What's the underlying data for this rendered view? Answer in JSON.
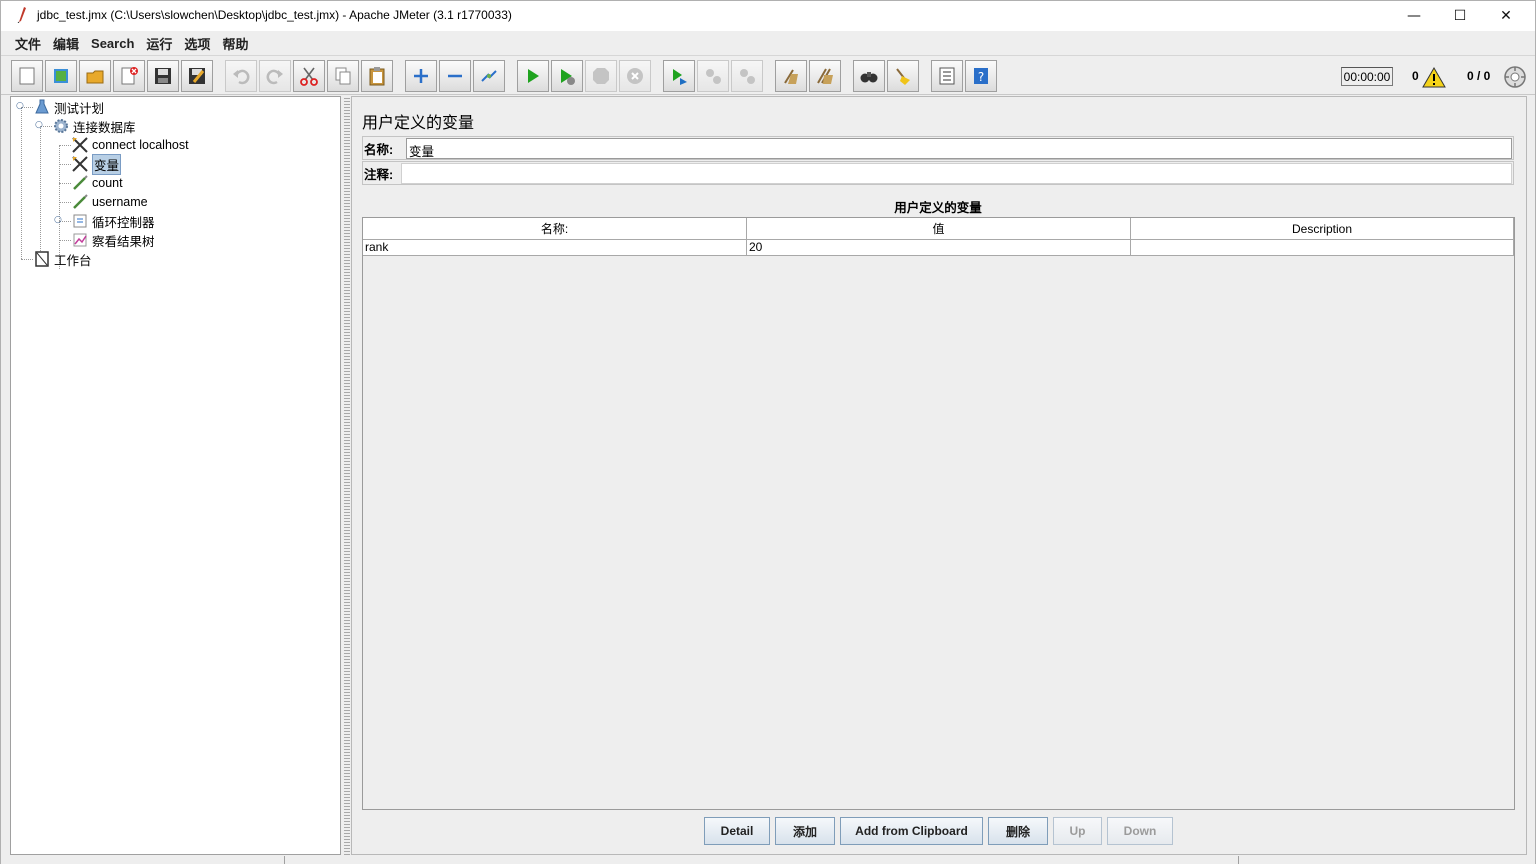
{
  "window": {
    "title": "jdbc_test.jmx (C:\\Users\\slowchen\\Desktop\\jdbc_test.jmx) - Apache JMeter (3.1 r1770033)",
    "controls": {
      "minimize": "—",
      "maximize": "☐",
      "close": "✕"
    }
  },
  "menubar": {
    "items": [
      "文件",
      "编辑",
      "Search",
      "运行",
      "选项",
      "帮助"
    ]
  },
  "toolbar": {
    "buttons": [
      "new-icon",
      "templates-icon",
      "open-icon",
      "close-file-icon",
      "save-icon",
      "save-as-icon",
      "undo-icon",
      "redo-icon",
      "cut-icon",
      "copy-icon",
      "paste-icon",
      "expand-icon",
      "collapse-icon",
      "toggle-icon",
      "start-icon",
      "start-no-pauses-icon",
      "stop-icon",
      "shutdown-icon",
      "remote-start-icon",
      "remote-stop-icon",
      "remote-shutdown-icon",
      "clear-icon",
      "clear-all-icon",
      "search-icon",
      "reset-search-icon",
      "function-helper-icon",
      "help-icon"
    ],
    "timer": "00:00:00",
    "warning_count": "0",
    "threads": "0 / 0"
  },
  "tree": {
    "nodes": [
      {
        "label": "测试计划",
        "icon": "test-plan-icon"
      },
      {
        "label": "连接数据库",
        "icon": "thread-group-gear-icon"
      },
      {
        "label": "connect localhost",
        "icon": "config-element-icon"
      },
      {
        "label": "变量",
        "icon": "config-element-icon",
        "selected": true
      },
      {
        "label": "count",
        "icon": "sampler-pen-icon"
      },
      {
        "label": "username",
        "icon": "sampler-pen-icon"
      },
      {
        "label": "循环控制器",
        "icon": "loop-controller-icon"
      },
      {
        "label": "察看结果树",
        "icon": "listener-chart-icon"
      },
      {
        "label": "工作台",
        "icon": "workbench-icon"
      }
    ]
  },
  "panel": {
    "title": "用户定义的变量",
    "name_label": "名称:",
    "name_value": "变量",
    "comment_label": "注释:",
    "comment_value": "",
    "table_title": "用户定义的变量",
    "columns": [
      "名称:",
      "值",
      "Description"
    ],
    "rows": [
      [
        "rank",
        "20",
        ""
      ]
    ],
    "buttons": [
      {
        "label": "Detail",
        "enabled": true
      },
      {
        "label": "添加",
        "enabled": true
      },
      {
        "label": "Add from Clipboard",
        "enabled": true
      },
      {
        "label": "删除",
        "enabled": true
      },
      {
        "label": "Up",
        "enabled": false
      },
      {
        "label": "Down",
        "enabled": false
      }
    ]
  },
  "colors": {
    "background": "#eeeeee",
    "selection": "#b8cfe5",
    "button_border": "#7f9db9",
    "start_green": "#1fa31f",
    "warning_yellow": "#f5d31a"
  }
}
